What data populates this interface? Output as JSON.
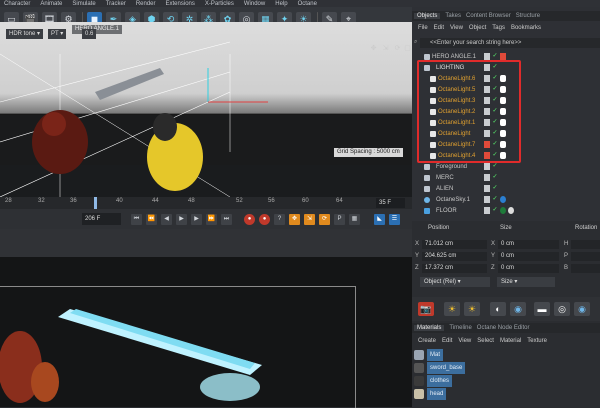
{
  "menu": [
    "Character",
    "Animate",
    "Simulate",
    "Tracker",
    "Render",
    "Extensions",
    "X-Particles",
    "Window",
    "Help",
    "Octane"
  ],
  "viewport": {
    "camera_label": "HERO ANGLE.1",
    "grid_spacing": "Grid Spacing : 5000 cm"
  },
  "timeline": {
    "ticks": [
      "28",
      "32",
      "36",
      "40",
      "44",
      "48",
      "52",
      "56",
      "60",
      "64"
    ],
    "end_frame": "35 F",
    "current_frame": "206 F"
  },
  "render_toolbar": {
    "tone_label": "HDR tone",
    "mode_label": "PT",
    "value": "0.6"
  },
  "objects": {
    "tabs": [
      "Objects",
      "Takes",
      "Content Browser",
      "Structure"
    ],
    "active_tab": "Objects",
    "menu": [
      "File",
      "Edit",
      "View",
      "Object",
      "Tags",
      "Bookmarks"
    ],
    "search_placeholder": "<<Enter your search string here>>",
    "rows": [
      {
        "label": "HERO ANGLE.1",
        "type": "camera"
      },
      {
        "label": "LIGHTING",
        "type": "null"
      },
      {
        "label": "OctaneLight.6",
        "type": "light"
      },
      {
        "label": "OctaneLight.5",
        "type": "light"
      },
      {
        "label": "OctaneLight.3",
        "type": "light"
      },
      {
        "label": "OctaneLight.2",
        "type": "light"
      },
      {
        "label": "OctaneLight.1",
        "type": "light"
      },
      {
        "label": "OctaneLight",
        "type": "light"
      },
      {
        "label": "OctaneLight.7",
        "type": "light"
      },
      {
        "label": "OctaneLight.4",
        "type": "light"
      },
      {
        "label": "Foreground",
        "type": "group"
      },
      {
        "label": "MERC",
        "type": "group"
      },
      {
        "label": "ALIEN",
        "type": "group"
      },
      {
        "label": "OctaneSky.1",
        "type": "sky"
      },
      {
        "label": "FLOOR",
        "type": "floor"
      }
    ]
  },
  "coordinates": {
    "position_label": "Position",
    "size_label": "Size",
    "rotation_label": "Rotation",
    "axes": [
      "X",
      "Y",
      "Z"
    ],
    "position": [
      "71.012 cm",
      "204.625 cm",
      "17.372 cm"
    ],
    "size": [
      "0 cm",
      "0 cm",
      "0 cm"
    ],
    "rotation_axes": [
      "H",
      "P",
      "B"
    ],
    "mode_dropdown": "Object (Rel)",
    "size_dropdown": "Size"
  },
  "materials": {
    "tabs": [
      "Materials",
      "Timeline",
      "Octane Node Editor"
    ],
    "active_tab": "Materials",
    "menu": [
      "Create",
      "Edit",
      "View",
      "Select",
      "Material",
      "Texture"
    ],
    "items": [
      "Mat",
      "sword_base",
      "clothes",
      "head"
    ]
  },
  "colors": {
    "highlight": "#e02b2b",
    "accent_blue": "#2b6fb3",
    "lighting_orange": "#e0a030"
  }
}
